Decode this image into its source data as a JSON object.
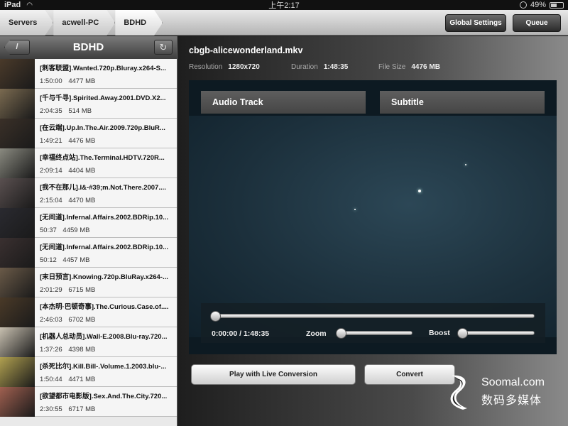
{
  "status_bar": {
    "device": "iPad",
    "time": "上午2:17",
    "battery": "49%"
  },
  "nav": {
    "crumbs": [
      "Servers",
      "acwell-PC",
      "BDHD"
    ],
    "global_settings": "Global Settings",
    "queue": "Queue"
  },
  "sidebar": {
    "title": "BDHD",
    "back_label": "/",
    "items": [
      {
        "name": "[刺客联盟].Wanted.720p.Bluray.x264-S...",
        "duration": "1:50:00",
        "size": "4477 MB",
        "thumb": "#4a3a2a"
      },
      {
        "name": "[千与千寻].Spirited.Away.2001.DVD.X2...",
        "duration": "2:04:35",
        "size": "514 MB",
        "thumb": "#7a6a50"
      },
      {
        "name": "[在云端].Up.In.The.Air.2009.720p.BluR...",
        "duration": "1:49:21",
        "size": "4476 MB",
        "thumb": "#3a3028"
      },
      {
        "name": "[幸福终点站].The.Terminal.HDTV.720R...",
        "duration": "2:09:14",
        "size": "4404 MB",
        "thumb": "#8a8a80"
      },
      {
        "name": "[我不在那儿].I&-#39;m.Not.There.2007....",
        "duration": "2:15:04",
        "size": "4470 MB",
        "thumb": "#5a5050"
      },
      {
        "name": "[无间道].Infernal.Affairs.2002.BDRip.10...",
        "duration": "50:37",
        "size": "4459 MB",
        "thumb": "#2a2a30"
      },
      {
        "name": "[无间道].Infernal.Affairs.2002.BDRip.10...",
        "duration": "50:12",
        "size": "4457 MB",
        "thumb": "#3a3030"
      },
      {
        "name": "[末日预言].Knowing.720p.BluRay.x264-...",
        "duration": "2:01:29",
        "size": "6715 MB",
        "thumb": "#6a5a48"
      },
      {
        "name": "[本杰明·巴顿奇事].The.Curious.Case.of....",
        "duration": "2:46:03",
        "size": "6702 MB",
        "thumb": "#4a3a28"
      },
      {
        "name": "[机器人总动员].Wall-E.2008.Blu-ray.720...",
        "duration": "1:37:26",
        "size": "4398 MB",
        "thumb": "#c8c0b0"
      },
      {
        "name": "[杀死比尔].Kill.Bill-.Volume.1.2003.blu-...",
        "duration": "1:50:44",
        "size": "4471 MB",
        "thumb": "#b0a050"
      },
      {
        "name": "[欲望都市电影版].Sex.And.The.City.720...",
        "duration": "2:30:55",
        "size": "6717 MB",
        "thumb": "#a06050"
      }
    ]
  },
  "detail": {
    "file_title": "cbgb-alicewonderland.mkv",
    "resolution_label": "Resolution",
    "resolution_value": "1280x720",
    "duration_label": "Duration",
    "duration_value": "1:48:35",
    "filesize_label": "File Size",
    "filesize_value": "4476 MB",
    "audio_track": "Audio Track",
    "subtitle": "Subtitle",
    "time_readout": "0:00:00 / 1:48:35",
    "playback_progress": 0.0,
    "zoom_label": "Zoom",
    "zoom_level": 0.0,
    "boost_label": "Boost",
    "boost_level": 0.0,
    "play_button": "Play with Live Conversion",
    "convert_button": "Convert"
  },
  "watermark": {
    "line1": "Soomal.com",
    "line2": "数码多媒体"
  },
  "colors": {
    "toolbar_dark": "#3e3e3e",
    "list_bg": "#f5f5f5",
    "accent_white": "#ffffff"
  }
}
